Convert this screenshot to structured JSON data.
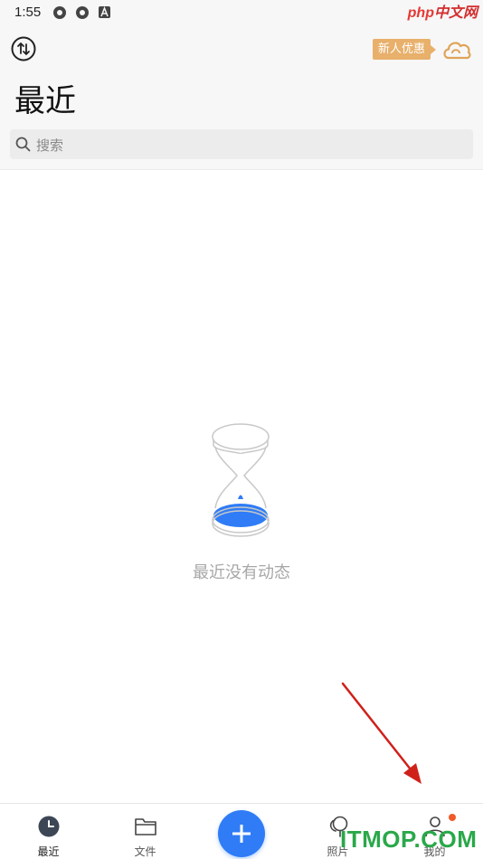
{
  "status_bar": {
    "time": "1:55"
  },
  "watermark_top": {
    "part_a": "php",
    "part_b": "中文网"
  },
  "header": {
    "promo_label": "新人优惠",
    "title": "最近"
  },
  "search": {
    "placeholder": "搜索"
  },
  "empty_state": {
    "message": "最近没有动态"
  },
  "tabbar": {
    "tabs": [
      {
        "label": "最近",
        "icon": "clock-icon",
        "active": true
      },
      {
        "label": "文件",
        "icon": "folder-icon",
        "active": false
      },
      {
        "label": "",
        "icon": "plus-icon",
        "active": false
      },
      {
        "label": "照片",
        "icon": "photo-balloon-icon",
        "active": false
      },
      {
        "label": "我的",
        "icon": "person-icon",
        "active": false
      }
    ]
  },
  "watermark_bottom": "ITMOP.COM",
  "colors": {
    "accent": "#2f7cf6",
    "promo": "#e8b06b",
    "notification_dot": "#f05a28",
    "arrow": "#d0201a"
  }
}
